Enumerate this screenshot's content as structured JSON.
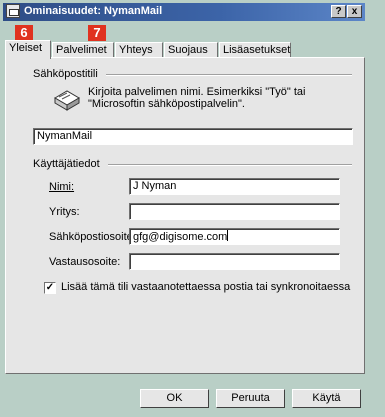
{
  "window": {
    "title": "Ominaisuudet: NymanMail",
    "help_button": "?",
    "close_button": "x"
  },
  "callouts": [
    "6",
    "7"
  ],
  "tabs": [
    {
      "label": "Yleiset",
      "active": true
    },
    {
      "label": "Palvelimet"
    },
    {
      "label": "Yhteys"
    },
    {
      "label": "Suojaus"
    },
    {
      "label": "Lisäasetukset"
    }
  ],
  "mail_account": {
    "group_label": "Sähköpostitili",
    "help_text": "Kirjoita palvelimen nimi. Esimerkiksi \"Työ\" tai \"Microsoftin sähköpostipalvelin\".",
    "account_name": "NymanMail"
  },
  "user_info": {
    "group_label": "Käyttäjätiedot",
    "name_label": "Nimi:",
    "name_value": "J Nyman",
    "company_label": "Yritys:",
    "company_value": "",
    "email_label": "Sähköpostiosoite:",
    "email_value": "gfg@digisome.com",
    "reply_label": "Vastausosoite:",
    "reply_value": ""
  },
  "include_checkbox": {
    "label": "Lisää tämä tili vastaanotettaessa postia tai synkronoitaessa",
    "checked": true,
    "mark": "✓"
  },
  "buttons": {
    "ok": "OK",
    "cancel": "Peruuta",
    "apply": "Käytä"
  },
  "colors": {
    "titlebar": "#2e4d86",
    "background": "#b9cfc6",
    "callout": "#e0321f"
  }
}
